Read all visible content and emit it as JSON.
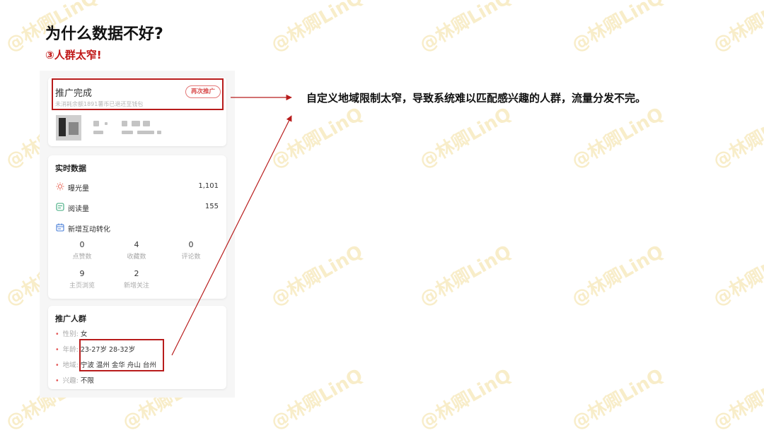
{
  "watermark": "@林卿LinQ",
  "header": {
    "title": "为什么数据不好?",
    "subtitle": "③人群太窄!"
  },
  "promo": {
    "status": "推广完成",
    "note": "未消耗余额1891薯币已退还至钱包",
    "button": "再次推广"
  },
  "realtime": {
    "title": "实时数据",
    "rows": [
      {
        "icon": "sun-icon",
        "label": "曝光量",
        "value": "1,101"
      },
      {
        "icon": "reading-icon",
        "label": "阅读量",
        "value": "155"
      },
      {
        "icon": "calendar-icon",
        "label": "新增互动转化",
        "value": ""
      }
    ],
    "stats": [
      {
        "value": "0",
        "label": "点赞数"
      },
      {
        "value": "4",
        "label": "收藏数"
      },
      {
        "value": "0",
        "label": "评论数"
      },
      {
        "value": "9",
        "label": "主页浏览"
      },
      {
        "value": "2",
        "label": "新增关注"
      }
    ]
  },
  "audience": {
    "title": "推广人群",
    "rows": [
      {
        "key": "性别:",
        "value": "女"
      },
      {
        "key": "年龄:",
        "value": "23-27岁 28-32岁"
      },
      {
        "key": "地域:",
        "value": "宁波 温州 金华 舟山 台州"
      },
      {
        "key": "兴趣:",
        "value": "不限"
      }
    ]
  },
  "annotation": "自定义地域限制太窄，导致系统难以匹配感兴趣的人群，流量分发不完。",
  "colors": {
    "accent": "#c01818",
    "box": "#b81c1c",
    "watermark": "#f6e7b8"
  }
}
